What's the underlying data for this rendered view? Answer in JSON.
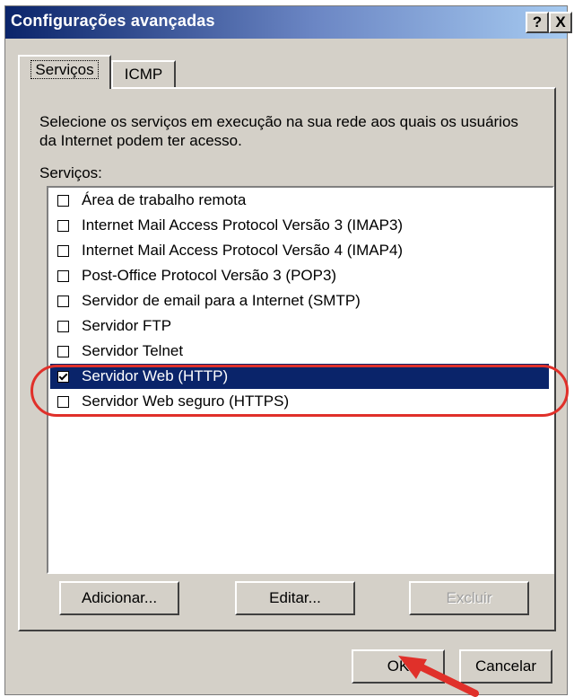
{
  "window": {
    "title": "Configurações avançadas",
    "help_glyph": "?",
    "close_glyph": "X"
  },
  "tabs": [
    {
      "label": "Serviços",
      "active": true
    },
    {
      "label": "ICMP",
      "active": false
    }
  ],
  "panel": {
    "description": "Selecione os serviços em execução na sua rede aos quais os usuários da Internet podem ter acesso.",
    "services_label": "Serviços:",
    "services": [
      {
        "label": "Área de trabalho remota",
        "checked": false
      },
      {
        "label": "Internet Mail Access Protocol Versão 3 (IMAP3)",
        "checked": false
      },
      {
        "label": "Internet Mail Access Protocol Versão 4 (IMAP4)",
        "checked": false
      },
      {
        "label": "Post-Office Protocol Versão 3 (POP3)",
        "checked": false
      },
      {
        "label": "Servidor de email para a Internet (SMTP)",
        "checked": false
      },
      {
        "label": "Servidor FTP",
        "checked": false
      },
      {
        "label": "Servidor Telnet",
        "checked": false
      },
      {
        "label": "Servidor Web (HTTP)",
        "checked": true,
        "selected": true
      },
      {
        "label": "Servidor Web seguro (HTTPS)",
        "checked": false
      }
    ],
    "buttons": {
      "add": "Adicionar...",
      "edit": "Editar...",
      "delete": "Excluir"
    }
  },
  "footer": {
    "ok": "OK",
    "cancel": "Cancelar"
  },
  "colors": {
    "selection": "#0a246a",
    "annotation": "#e0302a"
  }
}
